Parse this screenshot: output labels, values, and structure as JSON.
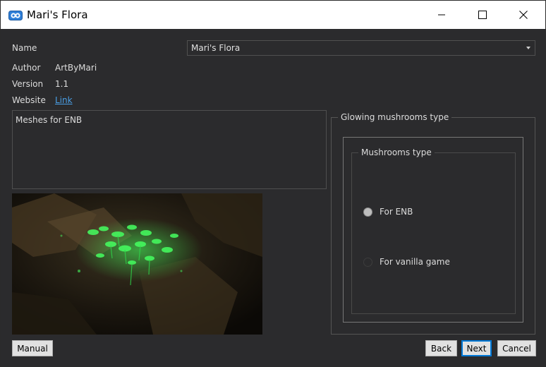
{
  "window": {
    "title": "Mari's Flora"
  },
  "fields": {
    "name_label": "Name",
    "name_value": "Mari's Flora",
    "author_label": "Author",
    "author_value": "ArtByMari",
    "version_label": "Version",
    "version_value": "1.1",
    "website_label": "Website",
    "website_link": "Link"
  },
  "description": "Meshes for ENB",
  "options_group": {
    "title": "Glowing mushrooms type",
    "inner_title": "Mushrooms type",
    "options": [
      {
        "label": "For ENB",
        "selected": true
      },
      {
        "label": "For vanilla game",
        "selected": false
      }
    ]
  },
  "buttons": {
    "manual": "Manual",
    "back": "Back",
    "next": "Next",
    "cancel": "Cancel"
  },
  "colors": {
    "background": "#2b2b2d",
    "link": "#4a9fe6",
    "accent_focus": "#0078d7",
    "glow": "#3cff5a"
  },
  "icons": [
    "app-icon",
    "minimize-icon",
    "maximize-icon",
    "close-icon",
    "dropdown-arrow-icon"
  ]
}
